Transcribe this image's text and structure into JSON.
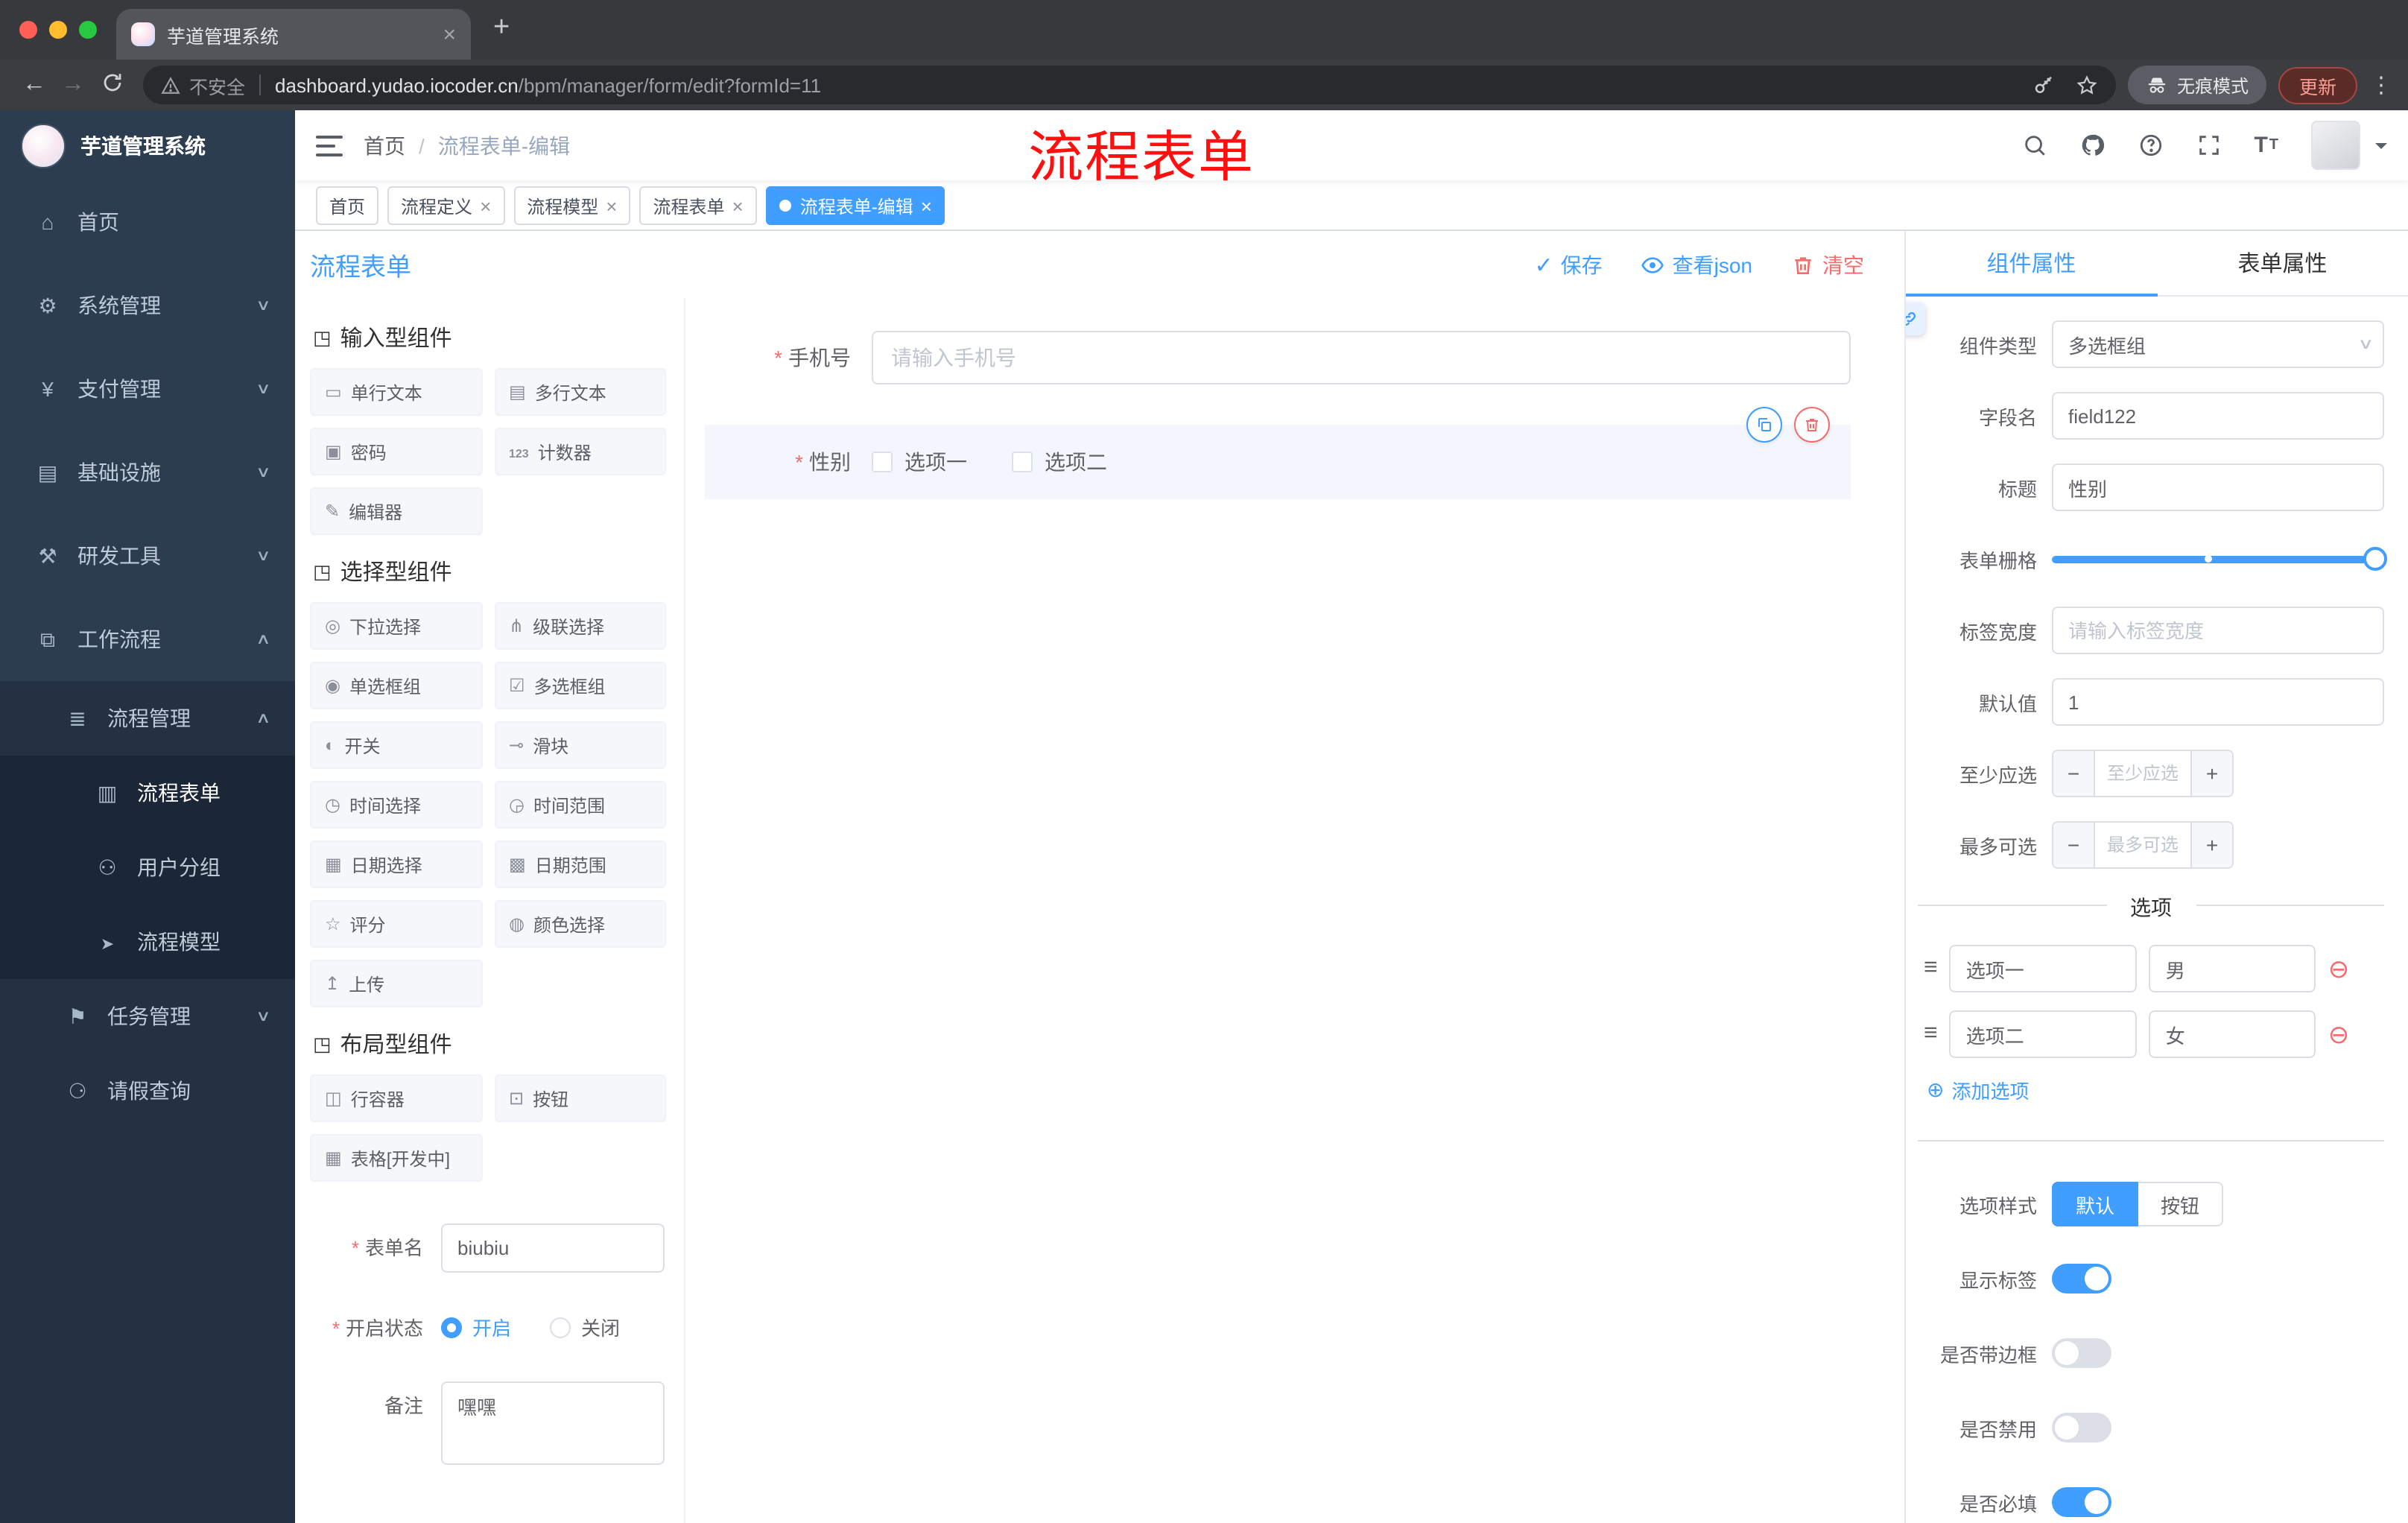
{
  "browser": {
    "tab_title": "芋道管理系统",
    "security_text": "不安全",
    "url_domain": "dashboard.yudao.iocoder.cn",
    "url_path": "/bpm/manager/form/edit?formId=11",
    "incognito_label": "无痕模式",
    "update_label": "更新"
  },
  "sidebar": {
    "logo_title": "芋道管理系统",
    "items": [
      {
        "label": "首页",
        "icon": "home-icon"
      },
      {
        "label": "系统管理",
        "icon": "system-icon"
      },
      {
        "label": "支付管理",
        "icon": "payment-icon"
      },
      {
        "label": "基础设施",
        "icon": "infrastructure-icon"
      },
      {
        "label": "研发工具",
        "icon": "devtools-icon"
      },
      {
        "label": "工作流程",
        "icon": "workflow-icon"
      },
      {
        "label": "流程管理",
        "icon": "process-management-icon"
      },
      {
        "label": "流程表单",
        "icon": "process-form-icon"
      },
      {
        "label": "用户分组",
        "icon": "user-group-icon"
      },
      {
        "label": "流程模型",
        "icon": "process-model-icon"
      },
      {
        "label": "任务管理",
        "icon": "task-management-icon"
      },
      {
        "label": "请假查询",
        "icon": "leave-query-icon"
      }
    ]
  },
  "header": {
    "breadcrumb_home": "首页",
    "breadcrumb_current": "流程表单-编辑",
    "annotation": "流程表单"
  },
  "tags": [
    {
      "label": "首页"
    },
    {
      "label": "流程定义"
    },
    {
      "label": "流程模型"
    },
    {
      "label": "流程表单"
    },
    {
      "label": "流程表单-编辑"
    }
  ],
  "designer": {
    "title": "流程表单",
    "actions": {
      "save": "保存",
      "view_json": "查看json",
      "clear": "清空"
    },
    "palette": {
      "sections": [
        {
          "title": "输入型组件",
          "items": [
            {
              "label": "单行文本",
              "icon": "single-line-text-icon"
            },
            {
              "label": "多行文本",
              "icon": "multi-line-text-icon"
            },
            {
              "label": "密码",
              "icon": "password-icon"
            },
            {
              "label": "计数器",
              "icon": "counter-icon"
            },
            {
              "label": "编辑器",
              "icon": "editor-icon"
            }
          ]
        },
        {
          "title": "选择型组件",
          "items": [
            {
              "label": "下拉选择",
              "icon": "select-icon"
            },
            {
              "label": "级联选择",
              "icon": "cascader-icon"
            },
            {
              "label": "单选框组",
              "icon": "radio-group-icon"
            },
            {
              "label": "多选框组",
              "icon": "checkbox-group-icon"
            },
            {
              "label": "开关",
              "icon": "switch-icon"
            },
            {
              "label": "滑块",
              "icon": "slider-icon"
            },
            {
              "label": "时间选择",
              "icon": "time-picker-icon"
            },
            {
              "label": "时间范围",
              "icon": "time-range-icon"
            },
            {
              "label": "日期选择",
              "icon": "date-picker-icon"
            },
            {
              "label": "日期范围",
              "icon": "date-range-icon"
            },
            {
              "label": "评分",
              "icon": "rate-icon"
            },
            {
              "label": "颜色选择",
              "icon": "color-picker-icon"
            },
            {
              "label": "上传",
              "icon": "upload-icon"
            }
          ]
        },
        {
          "title": "布局型组件",
          "items": [
            {
              "label": "行容器",
              "icon": "row-container-icon"
            },
            {
              "label": "按钮",
              "icon": "button-icon"
            },
            {
              "label": "表格[开发中]",
              "icon": "table-icon"
            }
          ]
        }
      ]
    },
    "meta": {
      "name_label": "表单名",
      "name_value": "biubiu",
      "status_label": "开启状态",
      "status_on": "开启",
      "status_off": "关闭",
      "remark_label": "备注",
      "remark_value": "嘿嘿"
    },
    "canvas": {
      "phone_label": "手机号",
      "phone_placeholder": "请输入手机号",
      "gender_label": "性别",
      "gender_option1": "选项一",
      "gender_option2": "选项二"
    }
  },
  "properties": {
    "tab_component": "组件属性",
    "tab_form": "表单属性",
    "component_type": {
      "label": "组件类型",
      "value": "多选框组"
    },
    "field_name": {
      "label": "字段名",
      "value": "field122"
    },
    "title": {
      "label": "标题",
      "value": "性别"
    },
    "grid": {
      "label": "表单栅格"
    },
    "label_width": {
      "label": "标签宽度",
      "placeholder": "请输入标签宽度"
    },
    "default_value": {
      "label": "默认值",
      "value": "1"
    },
    "min_checked": {
      "label": "至少应选",
      "placeholder": "至少应选"
    },
    "max_checked": {
      "label": "最多可选",
      "placeholder": "最多可选"
    },
    "options_title": "选项",
    "options": [
      {
        "label": "选项一",
        "value": "男"
      },
      {
        "label": "选项二",
        "value": "女"
      }
    ],
    "add_option": "添加选项",
    "option_style": {
      "label": "选项样式",
      "opt_default": "默认",
      "opt_button": "按钮"
    },
    "toggles": [
      {
        "label": "显示标签",
        "on": true
      },
      {
        "label": "是否带边框",
        "on": false
      },
      {
        "label": "是否禁用",
        "on": false
      },
      {
        "label": "是否必填",
        "on": true
      }
    ]
  },
  "colors": {
    "accent": "#409eff",
    "danger": "#f56c6c",
    "annotation": "#ff0000"
  }
}
